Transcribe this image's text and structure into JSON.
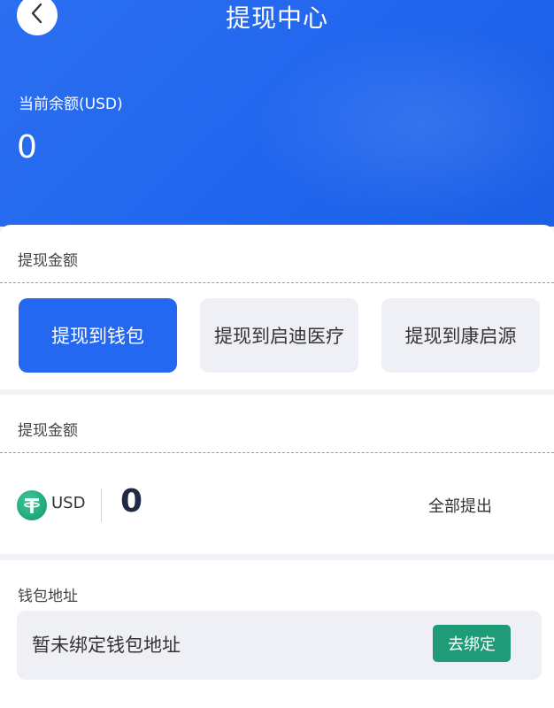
{
  "header": {
    "title": "提现中心",
    "balance_label": "当前余额(USD)",
    "balance_value": "0",
    "back_icon": "chevron-left-icon"
  },
  "withdraw_target": {
    "title": "提现金额",
    "options": [
      {
        "label": "提现到钱包",
        "selected": true
      },
      {
        "label": "提现到启迪医疗",
        "selected": false
      },
      {
        "label": "提现到康启源",
        "selected": false
      }
    ]
  },
  "amount_section": {
    "title": "提现金额",
    "currency_icon": "tether-coin-icon",
    "currency": "USD",
    "amount": "0",
    "withdraw_all_label": "全部提出"
  },
  "wallet_section": {
    "title": "钱包地址",
    "address_placeholder": "暂未绑定钱包地址",
    "bind_button_label": "去绑定"
  },
  "colors": {
    "primary": "#2468f2",
    "header_bg": "#2166ee",
    "option_inactive_bg": "#eef0f6",
    "bind_button": "#1f9b78",
    "coin": "#26a17b"
  }
}
